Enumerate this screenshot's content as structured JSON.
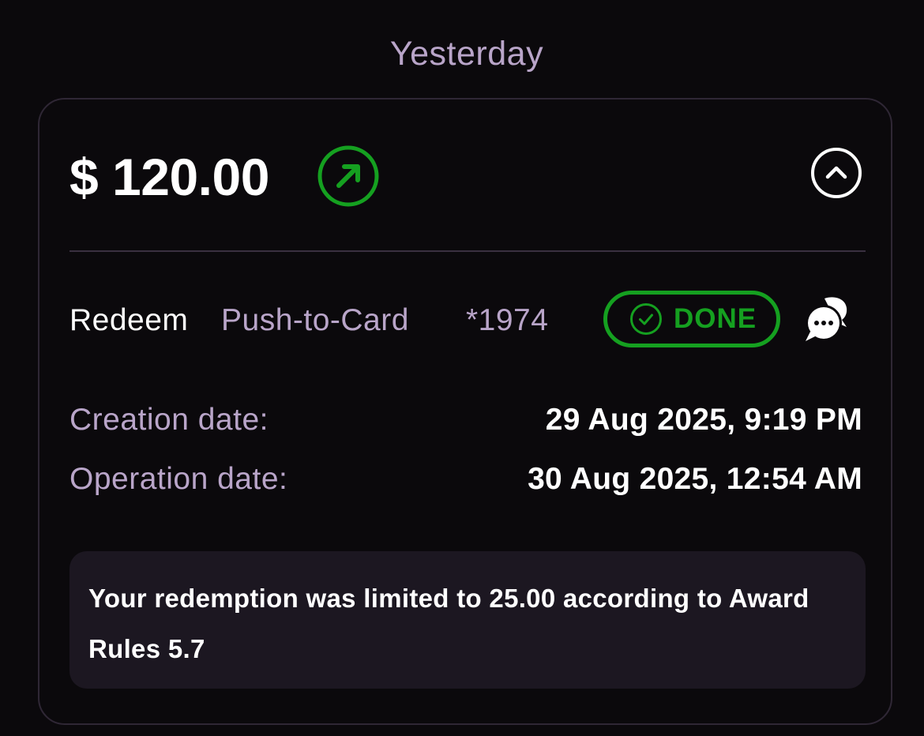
{
  "section": {
    "title": "Yesterday"
  },
  "transaction": {
    "amount": "$ 120.00",
    "direction_icon": "arrow-up-right-icon",
    "collapse_icon": "chevron-up-icon",
    "operation_type": "Redeem",
    "method": "Push-to-Card",
    "card_suffix": "*1974",
    "status": {
      "label": "DONE",
      "icon": "check-circle-icon",
      "color": "#15a020"
    },
    "chat_icon": "chat-bubbles-icon",
    "details": {
      "creation_label": "Creation date:",
      "creation_value": "29 Aug 2025, 9:19 PM",
      "operation_label": "Operation date:",
      "operation_value": "30 Aug 2025, 12:54 AM"
    },
    "note": "Your redemption was limited to 25.00 according to Award Rules 5.7"
  },
  "colors": {
    "background": "#0b090c",
    "accent_label": "#b9a5c9",
    "success": "#15a020",
    "card_border": "#2f2735",
    "note_background": "#1c1721"
  }
}
